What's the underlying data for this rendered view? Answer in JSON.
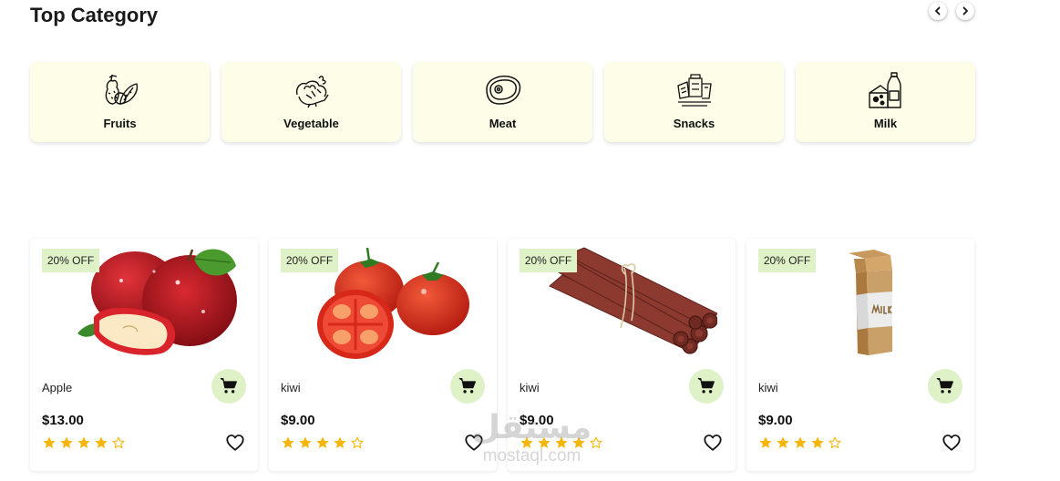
{
  "section": {
    "title": "Top Category"
  },
  "nav": {
    "prev_icon": "chevron-left-icon",
    "next_icon": "chevron-right-icon"
  },
  "categories": [
    {
      "label": "Fruits",
      "icon": "fruits-icon"
    },
    {
      "label": "Vegetable",
      "icon": "vegetable-icon"
    },
    {
      "label": "Meat",
      "icon": "meat-icon"
    },
    {
      "label": "Snacks",
      "icon": "snacks-icon"
    },
    {
      "label": "Milk",
      "icon": "milk-icon"
    }
  ],
  "products": [
    {
      "badge": "20% OFF",
      "name": "Apple",
      "price": "$13.00",
      "rating": 4,
      "rating_max": 5,
      "image": "apple-image"
    },
    {
      "badge": "20% OFF",
      "name": "kiwi",
      "price": "$9.00",
      "rating": 4,
      "rating_max": 5,
      "image": "tomato-image"
    },
    {
      "badge": "20% OFF",
      "name": "kiwi",
      "price": "$9.00",
      "rating": 4,
      "rating_max": 5,
      "image": "meat-sticks-image"
    },
    {
      "badge": "20% OFF",
      "name": "kiwi",
      "price": "$9.00",
      "rating": 4,
      "rating_max": 5,
      "image": "milk-carton-image"
    }
  ],
  "watermark": {
    "arabic": "مستقل",
    "latin": "mostaql.com"
  },
  "colors": {
    "category_bg": "#fdfde8",
    "badge_bg": "#dff1c6",
    "star": "#f5b50a"
  }
}
